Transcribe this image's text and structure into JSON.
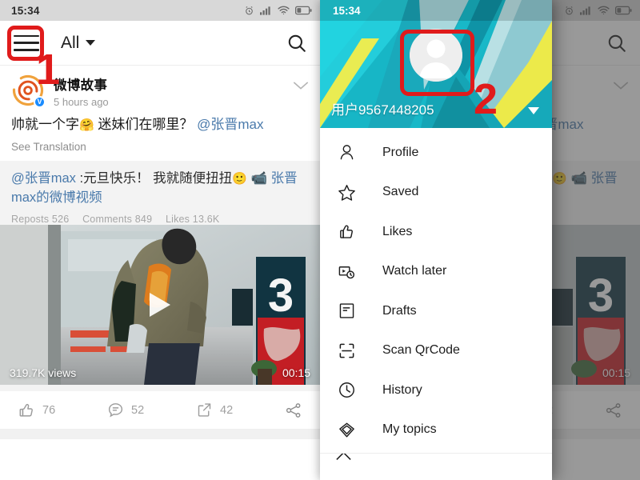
{
  "statusbar": {
    "time": "15:34",
    "icons": [
      "alarm-icon",
      "signal-icon",
      "wifi-icon",
      "battery-icon"
    ]
  },
  "appbar": {
    "menu_icon": "hamburger-menu-icon",
    "filter_label": "All",
    "filter_caret_icon": "caret-down-icon",
    "search_icon": "search-icon"
  },
  "post": {
    "author": "微博故事",
    "verified_badge": "V",
    "time": "5 hours ago",
    "collapse_icon": "chevron-down-icon",
    "text_main": "帅就一个字",
    "text_emoji1": "🤗",
    "text_rest": " 迷妹们在哪里？  ",
    "text_mention": "@张晋max",
    "see_translation": "See Translation",
    "quote_mention": "@张晋max",
    "quote_body": " :元旦快乐！ 我就随便扭扭",
    "quote_emoji": "🙂",
    "quote_video_icon": "video-camera-icon",
    "quote_link": "张晋max的微博视频",
    "stats_reposts": "Reposts 526",
    "stats_comments": "Comments 849",
    "stats_likes": "Likes 13.6K",
    "video_views": "319.7K views",
    "video_duration": "00:15",
    "play_icon": "play-icon"
  },
  "actions": [
    {
      "icon": "thumbs-up-icon",
      "count": "76"
    },
    {
      "icon": "comment-icon",
      "count": "52"
    },
    {
      "icon": "repost-icon",
      "count": "42"
    },
    {
      "icon": "share-icon",
      "count": ""
    }
  ],
  "drawer": {
    "status_time": "15:34",
    "avatar_icon": "user-avatar-icon",
    "username": "用户9567448205",
    "expand_caret_icon": "caret-down-icon",
    "items": [
      {
        "icon": "person-icon",
        "label": "Profile"
      },
      {
        "icon": "star-icon",
        "label": "Saved"
      },
      {
        "icon": "thumbs-up-icon",
        "label": "Likes"
      },
      {
        "icon": "watch-later-icon",
        "label": "Watch later"
      },
      {
        "icon": "drafts-icon",
        "label": "Drafts"
      },
      {
        "icon": "qrcode-scan-icon",
        "label": "Scan QrCode"
      },
      {
        "icon": "clock-icon",
        "label": "History"
      },
      {
        "icon": "diamond-icon",
        "label": "My topics"
      }
    ],
    "partial_item_icon": "diamond-outline-icon"
  },
  "annotations": [
    {
      "name": "step-1",
      "number": "1",
      "target": "hamburger-menu-icon"
    },
    {
      "name": "step-2",
      "number": "2",
      "target": "drawer-avatar"
    }
  ],
  "colors": {
    "annotation_red": "#e01b1b",
    "drawer_teal": "#1eb8c8",
    "drawer_yellow": "#ecea4a",
    "verified_blue": "#1a8cff",
    "mention_blue": "#4a7aab",
    "statusbar_gray": "#d8d8d8"
  }
}
